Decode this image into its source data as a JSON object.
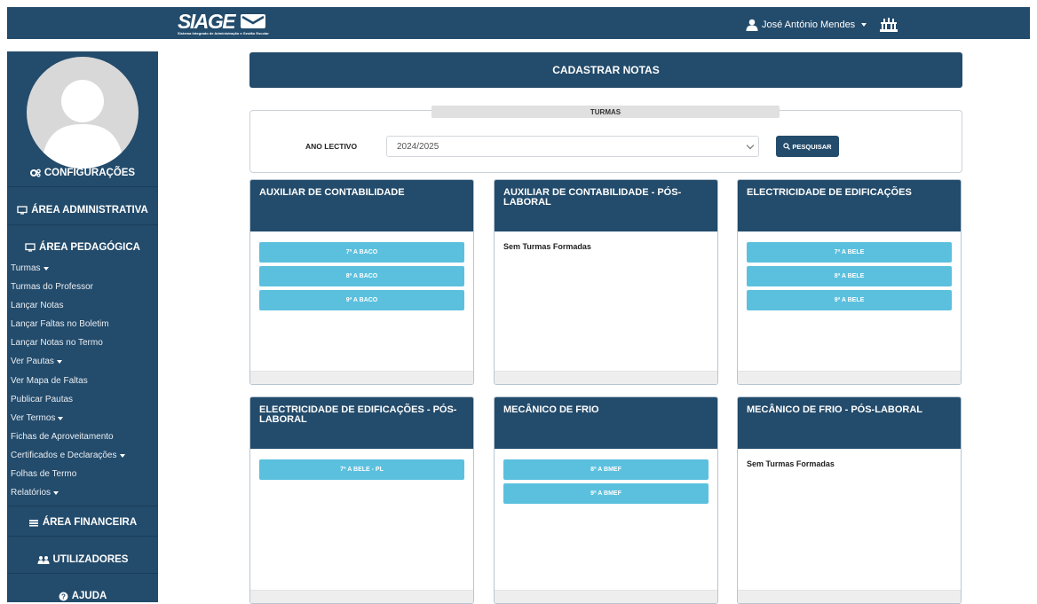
{
  "header": {
    "logo_text": "SIAGE",
    "logo_subtitle": "Sistema Integrado de Administração e Gestão Escolar",
    "user_name": "José António Mendes",
    "icons": [
      "user-icon",
      "school-icon"
    ]
  },
  "sidebar": {
    "headings": {
      "configuracoes": "CONFIGURAÇÕES",
      "administrativa": "ÁREA ADMINISTRATIVA",
      "pedagogica": "ÁREA PEDAGÓGICA",
      "financeira": "ÁREA FINANCEIRA",
      "utilizadores": "UTILIZADORES",
      "ajuda": "AJUDA"
    },
    "links": [
      {
        "label": "Turmas",
        "dropdown": true
      },
      {
        "label": "Turmas do Professor",
        "dropdown": false
      },
      {
        "label": "Lançar Notas",
        "dropdown": false
      },
      {
        "label": "Lançar Faltas no Boletim",
        "dropdown": false
      },
      {
        "label": "Lançar Notas no Termo",
        "dropdown": false
      },
      {
        "label": "Ver Pautas",
        "dropdown": true
      },
      {
        "label": "Ver Mapa de Faltas",
        "dropdown": false
      },
      {
        "label": "Publicar Pautas",
        "dropdown": false
      },
      {
        "label": "Ver Termos",
        "dropdown": true
      },
      {
        "label": "Fichas de Aproveitamento",
        "dropdown": false
      },
      {
        "label": "Certificados e Declarações",
        "dropdown": true
      },
      {
        "label": "Folhas de Termo",
        "dropdown": false
      },
      {
        "label": "Relatórios",
        "dropdown": true
      }
    ]
  },
  "main": {
    "title": "CADASTRAR NOTAS",
    "filter": {
      "section_label": "TURMAS",
      "ano_label": "ANO LECTIVO",
      "ano_value": "2024/2025",
      "search_label": "PESQUISAR"
    },
    "empty_text": "Sem Turmas Formadas",
    "courses": [
      {
        "title": "AUXILIAR DE CONTABILIDADE",
        "turmas": [
          "7ª A BACO",
          "8ª A BACO",
          "9ª A BACO"
        ]
      },
      {
        "title": "AUXILIAR DE CONTABILIDADE - PÓS-LABORAL",
        "turmas": []
      },
      {
        "title": "ELECTRICIDADE DE EDIFICAÇÕES",
        "turmas": [
          "7ª A BELE",
          "8ª A BELE",
          "9ª A BELE"
        ]
      },
      {
        "title": "ELECTRICIDADE DE EDIFICAÇÕES - PÓS-LABORAL",
        "turmas": [
          "7ª A BELE - PL"
        ]
      },
      {
        "title": "MECÂNICO DE FRIO",
        "turmas": [
          "8ª A BMEF",
          "9ª A BMEF"
        ]
      },
      {
        "title": "MECÂNICO DE FRIO - PÓS-LABORAL",
        "turmas": []
      }
    ]
  },
  "colors": {
    "navy": "#234b6b",
    "turma_button": "#5bc0de"
  }
}
